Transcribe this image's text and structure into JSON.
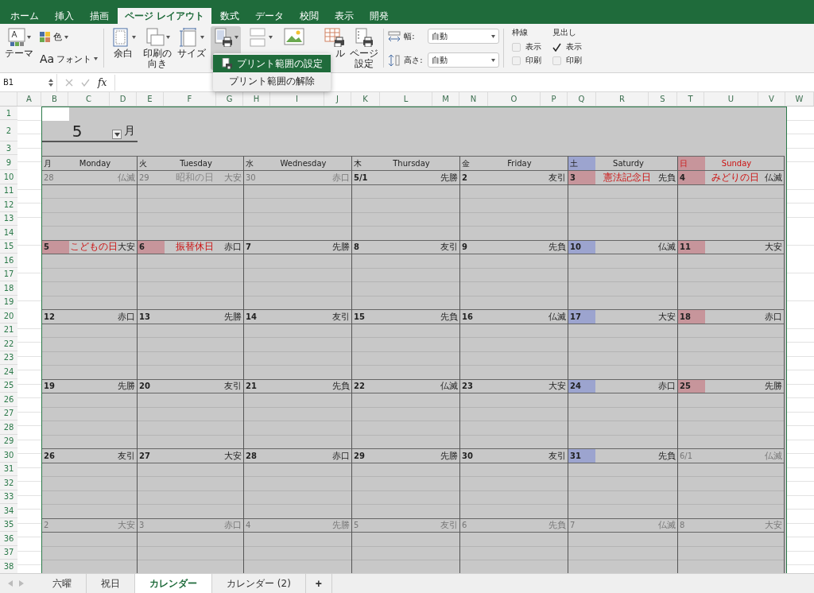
{
  "ribbon_tabs": [
    {
      "label": "ホーム",
      "selected": false
    },
    {
      "label": "挿入",
      "selected": false
    },
    {
      "label": "描画",
      "selected": false
    },
    {
      "label": "ページ レイアウト",
      "selected": true
    },
    {
      "label": "数式",
      "selected": false
    },
    {
      "label": "データ",
      "selected": false
    },
    {
      "label": "校閲",
      "selected": false
    },
    {
      "label": "表示",
      "selected": false
    },
    {
      "label": "開発",
      "selected": false
    }
  ],
  "ribbon": {
    "themes": {
      "label": "テーマ"
    },
    "colors": {
      "label": "色"
    },
    "fonts": {
      "glyph": "Aa",
      "label": "フォント"
    },
    "page_buttons": [
      {
        "kind": "margins",
        "label_lines": [
          "余白"
        ],
        "dropdown": true,
        "pressed": false
      },
      {
        "kind": "orientation",
        "label_lines": [
          "印刷の",
          "向き"
        ],
        "dropdown": true,
        "pressed": false
      },
      {
        "kind": "size",
        "label_lines": [
          "サイズ"
        ],
        "dropdown": true,
        "pressed": false
      },
      {
        "kind": "print_area",
        "dropdown": true,
        "pressed": true
      },
      {
        "kind": "breaks",
        "dropdown": true,
        "pressed": false
      },
      {
        "kind": "background",
        "dropdown": false,
        "pressed": false
      },
      {
        "kind": "print_titles",
        "label_lines": [
          "ル"
        ],
        "dropdown": false,
        "pressed": false
      },
      {
        "kind": "page_setup",
        "label_lines": [
          "ページ",
          "設定"
        ],
        "dropdown": false,
        "pressed": false
      }
    ],
    "scale": [
      {
        "kind": "width",
        "label": "幅:",
        "value": "自動"
      },
      {
        "kind": "height",
        "label": "高さ:",
        "value": "自動"
      }
    ],
    "sheet_options": [
      {
        "title": "枠線",
        "options": [
          {
            "label": "表示",
            "checked": false
          },
          {
            "label": "印刷",
            "checked": false
          }
        ]
      },
      {
        "title": "見出し",
        "options": [
          {
            "label": "表示",
            "checked": true
          },
          {
            "label": "印刷",
            "checked": false
          }
        ]
      }
    ]
  },
  "dropdown_menu": [
    {
      "label": "プリント範囲の設定",
      "selected": true
    },
    {
      "label": "プリント範囲の解除",
      "selected": false
    }
  ],
  "formula_bar": {
    "name_box": "B1",
    "function_label": "fx"
  },
  "sheet": {
    "columns": [
      "A",
      "B",
      "C",
      "D",
      "E",
      "F",
      "G",
      "H",
      "I",
      "J",
      "K",
      "L",
      "M",
      "N",
      "O",
      "P",
      "Q",
      "R",
      "S",
      "T",
      "U",
      "V",
      "W"
    ],
    "rows": [
      "1",
      "2",
      "3",
      "9",
      "10",
      "11",
      "12",
      "13",
      "14",
      "15",
      "16",
      "17",
      "18",
      "19",
      "20",
      "21",
      "22",
      "23",
      "24",
      "25",
      "26",
      "27",
      "28",
      "29",
      "30",
      "31",
      "32",
      "33",
      "34",
      "35",
      "36",
      "37",
      "38"
    ]
  },
  "calendar": {
    "month": "5",
    "month_suffix": "月",
    "headers": [
      {
        "kanji": "月",
        "english": "Monday",
        "kind": "weekday"
      },
      {
        "kanji": "火",
        "english": "Tuesday",
        "kind": "weekday"
      },
      {
        "kanji": "水",
        "english": "Wednesday",
        "kind": "weekday"
      },
      {
        "kanji": "木",
        "english": "Thursday",
        "kind": "weekday"
      },
      {
        "kanji": "金",
        "english": "Friday",
        "kind": "weekday"
      },
      {
        "kanji": "土",
        "english": "Saturdy",
        "kind": "saturday"
      },
      {
        "kanji": "日",
        "english": "Sunday",
        "kind": "sunday"
      }
    ],
    "weeks": [
      {
        "days": [
          {
            "date": "28",
            "rokuyo": "仏滅",
            "kind": "plain",
            "in_month": false
          },
          {
            "date": "29",
            "holiday": "昭和の日",
            "rokuyo": "大安",
            "kind": "plain",
            "in_month": false
          },
          {
            "date": "30",
            "rokuyo": "赤口",
            "kind": "plain",
            "in_month": false
          },
          {
            "date": "5/1",
            "rokuyo": "先勝",
            "kind": "plain",
            "in_month": true
          },
          {
            "date": "2",
            "rokuyo": "友引",
            "kind": "plain",
            "in_month": true
          },
          {
            "date": "3",
            "holiday": "憲法記念日",
            "rokuyo": "先負",
            "kind": "holiday",
            "in_month": true
          },
          {
            "date": "4",
            "holiday": "みどりの日",
            "rokuyo": "仏滅",
            "kind": "holiday",
            "in_month": true
          }
        ]
      },
      {
        "days": [
          {
            "date": "5",
            "holiday": "こどもの日",
            "rokuyo": "大安",
            "kind": "holiday",
            "in_month": true
          },
          {
            "date": "6",
            "holiday": "振替休日",
            "rokuyo": "赤口",
            "kind": "holiday",
            "in_month": true
          },
          {
            "date": "7",
            "rokuyo": "先勝",
            "kind": "plain",
            "in_month": true
          },
          {
            "date": "8",
            "rokuyo": "友引",
            "kind": "plain",
            "in_month": true
          },
          {
            "date": "9",
            "rokuyo": "先負",
            "kind": "plain",
            "in_month": true
          },
          {
            "date": "10",
            "rokuyo": "仏滅",
            "kind": "saturday",
            "in_month": true
          },
          {
            "date": "11",
            "rokuyo": "大安",
            "kind": "holiday",
            "in_month": true
          }
        ]
      },
      {
        "days": [
          {
            "date": "12",
            "rokuyo": "赤口",
            "kind": "plain",
            "in_month": true
          },
          {
            "date": "13",
            "rokuyo": "先勝",
            "kind": "plain",
            "in_month": true
          },
          {
            "date": "14",
            "rokuyo": "友引",
            "kind": "plain",
            "in_month": true
          },
          {
            "date": "15",
            "rokuyo": "先負",
            "kind": "plain",
            "in_month": true
          },
          {
            "date": "16",
            "rokuyo": "仏滅",
            "kind": "plain",
            "in_month": true
          },
          {
            "date": "17",
            "rokuyo": "大安",
            "kind": "saturday",
            "in_month": true
          },
          {
            "date": "18",
            "rokuyo": "赤口",
            "kind": "holiday",
            "in_month": true
          }
        ]
      },
      {
        "days": [
          {
            "date": "19",
            "rokuyo": "先勝",
            "kind": "plain",
            "in_month": true
          },
          {
            "date": "20",
            "rokuyo": "友引",
            "kind": "plain",
            "in_month": true
          },
          {
            "date": "21",
            "rokuyo": "先負",
            "kind": "plain",
            "in_month": true
          },
          {
            "date": "22",
            "rokuyo": "仏滅",
            "kind": "plain",
            "in_month": true
          },
          {
            "date": "23",
            "rokuyo": "大安",
            "kind": "plain",
            "in_month": true
          },
          {
            "date": "24",
            "rokuyo": "赤口",
            "kind": "saturday",
            "in_month": true
          },
          {
            "date": "25",
            "rokuyo": "先勝",
            "kind": "holiday",
            "in_month": true
          }
        ]
      },
      {
        "days": [
          {
            "date": "26",
            "rokuyo": "友引",
            "kind": "plain",
            "in_month": true
          },
          {
            "date": "27",
            "rokuyo": "大安",
            "kind": "plain",
            "in_month": true
          },
          {
            "date": "28",
            "rokuyo": "赤口",
            "kind": "plain",
            "in_month": true
          },
          {
            "date": "29",
            "rokuyo": "先勝",
            "kind": "plain",
            "in_month": true
          },
          {
            "date": "30",
            "rokuyo": "友引",
            "kind": "plain",
            "in_month": true
          },
          {
            "date": "31",
            "rokuyo": "先負",
            "kind": "saturday",
            "in_month": true
          },
          {
            "date": "6/1",
            "rokuyo": "仏滅",
            "kind": "plain",
            "in_month": false
          }
        ]
      },
      {
        "days": [
          {
            "date": "2",
            "rokuyo": "大安",
            "kind": "plain",
            "in_month": false
          },
          {
            "date": "3",
            "rokuyo": "赤口",
            "kind": "plain",
            "in_month": false
          },
          {
            "date": "4",
            "rokuyo": "先勝",
            "kind": "plain",
            "in_month": false
          },
          {
            "date": "5",
            "rokuyo": "友引",
            "kind": "plain",
            "in_month": false
          },
          {
            "date": "6",
            "rokuyo": "先負",
            "kind": "plain",
            "in_month": false
          },
          {
            "date": "7",
            "rokuyo": "仏滅",
            "kind": "plain",
            "in_month": false
          },
          {
            "date": "8",
            "rokuyo": "大安",
            "kind": "plain",
            "in_month": false
          }
        ]
      }
    ]
  },
  "sheet_tabs": [
    {
      "label": "六曜",
      "selected": false
    },
    {
      "label": "祝日",
      "selected": false
    },
    {
      "label": "カレンダー",
      "selected": true
    },
    {
      "label": "カレンダー (2)",
      "selected": false
    }
  ],
  "add_sheet": "+"
}
